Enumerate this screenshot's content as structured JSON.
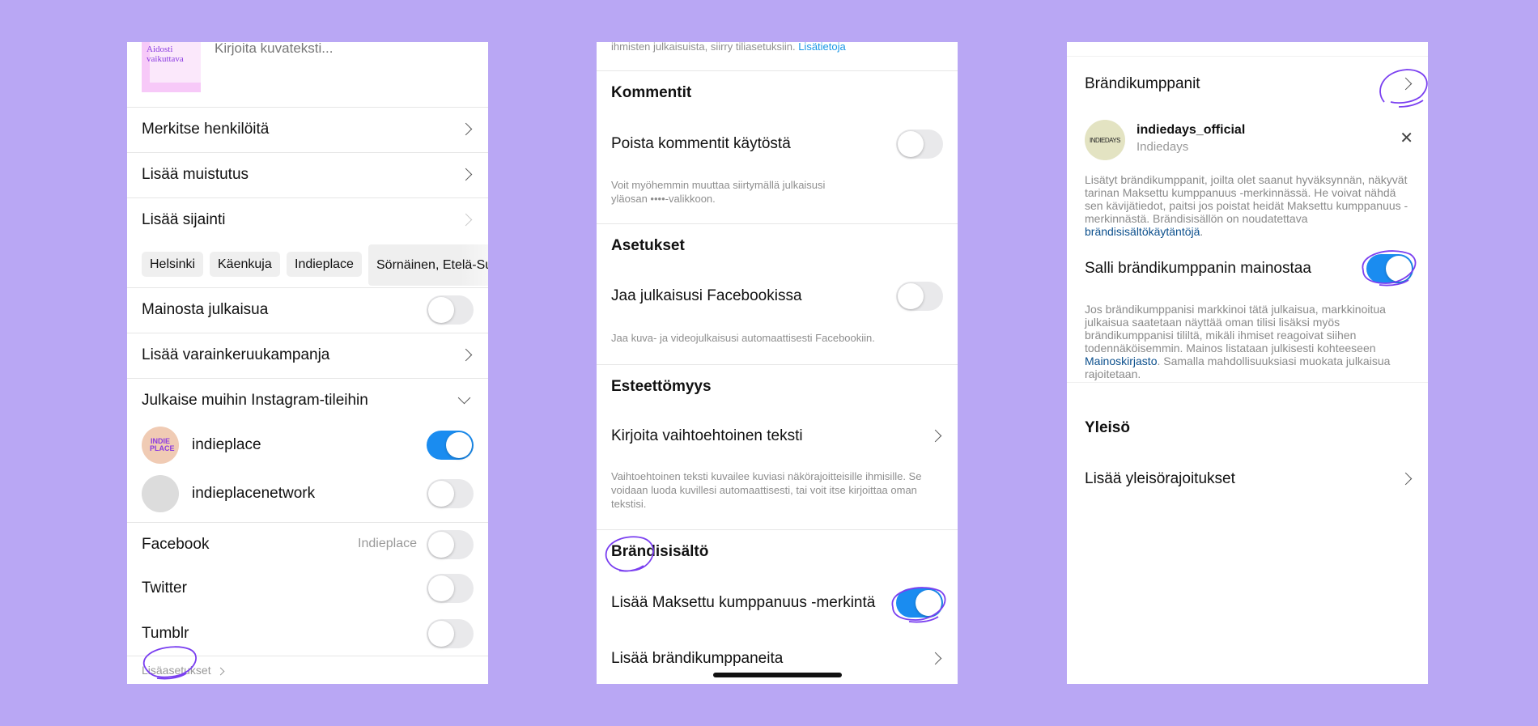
{
  "colors": {
    "background": "#b9a7f4",
    "toggle_on": "#1a8cf0",
    "toggle_off": "#e9e9eb",
    "link": "#1a97e6",
    "annotation": "#7a3ff0"
  },
  "panel1": {
    "thumbnail_text": "Aidosti vaikuttava",
    "caption_placeholder": "Kirjoita kuvateksti...",
    "tag_people": "Merkitse henkilöitä",
    "add_reminder": "Lisää muistutus",
    "add_location": "Lisää sijainti",
    "location_chips": [
      "Helsinki",
      "Käenkuja",
      "Indieplace",
      "Sörnäinen, Etelä-Su"
    ],
    "promote_post": {
      "label": "Mainosta julkaisua",
      "on": false
    },
    "fundraiser": "Lisää varainkeruukampanja",
    "other_accounts": "Julkaise muihin Instagram-tileihin",
    "accounts": [
      {
        "name": "indieplace",
        "avatar_text": "INDIE PLACE",
        "on": true
      },
      {
        "name": "indieplacenetwork",
        "on": false
      }
    ],
    "facebook": {
      "label": "Facebook",
      "account": "Indieplace",
      "on": false
    },
    "twitter": {
      "label": "Twitter",
      "on": false
    },
    "tumblr": {
      "label": "Tumblr",
      "on": false
    },
    "advanced_settings": "Lisäasetukset"
  },
  "panel2": {
    "top_text": "ihmisten julkaisuista, siirry tiliasetuksiin.",
    "top_link": "Lisätietoja",
    "comments_header": "Kommentit",
    "disable_comments": {
      "label": "Poista kommentit käytöstä",
      "on": false
    },
    "comments_help": "Voit myöhemmin muuttaa siirtymällä julkaisusi yläosan ••••-valikkoon.",
    "settings_header": "Asetukset",
    "share_facebook": {
      "label": "Jaa julkaisusi Facebookissa",
      "on": false
    },
    "share_help": "Jaa kuva- ja videojulkaisusi automaattisesti Facebookiin.",
    "accessibility_header": "Esteettömyys",
    "alt_text": "Kirjoita vaihtoehtoinen teksti",
    "alt_help": "Vaihtoehtoinen teksti kuvailee kuviasi näkörajoitteisille ihmisille. Se voidaan luoda kuvillesi automaattisesti, tai voit itse kirjoittaa oman tekstisi.",
    "branded_header": "Brändisisältö",
    "paid_partnership": {
      "label": "Lisää Maksettu kumppanuus -merkintä",
      "on": true
    },
    "add_partners": "Lisää brändikumppaneita"
  },
  "panel3": {
    "partners_label": "Brändikumppanit",
    "partner": {
      "username": "indiedays_official",
      "name": "Indiedays",
      "avatar_text": "INDIEDAYS"
    },
    "partners_help": "Lisätyt brändikumppanit, joilta olet saanut hyväksynnän, näkyvät tarinan Maksettu kumppanuus -merkinnässä. He voivat nähdä sen kävijätiedot, paitsi jos poistat heidät Maksettu kumppanuus -merkinnästä. Brändisisällön on noudatettava",
    "partners_link": "brändisisältökäytäntöjä",
    "allow_ads": {
      "label": "Salli brändikumppanin mainostaa",
      "on": true
    },
    "ads_help": "Jos brändikumppanisi markkinoi tätä julkaisua, markkinoitua julkaisua saatetaan näyttää oman tilisi lisäksi myös brändikumppanisi tililtä, mikäli ihmiset reagoivat siihen todennäköisemmin. Mainos listataan julkisesti kohteeseen",
    "ads_link": "Mainoskirjasto",
    "ads_help_end": ". Samalla mahdollisuuksiasi muokata julkaisua rajoitetaan.",
    "audience_header": "Yleisö",
    "audience_restrictions": "Lisää yleisörajoitukset"
  }
}
